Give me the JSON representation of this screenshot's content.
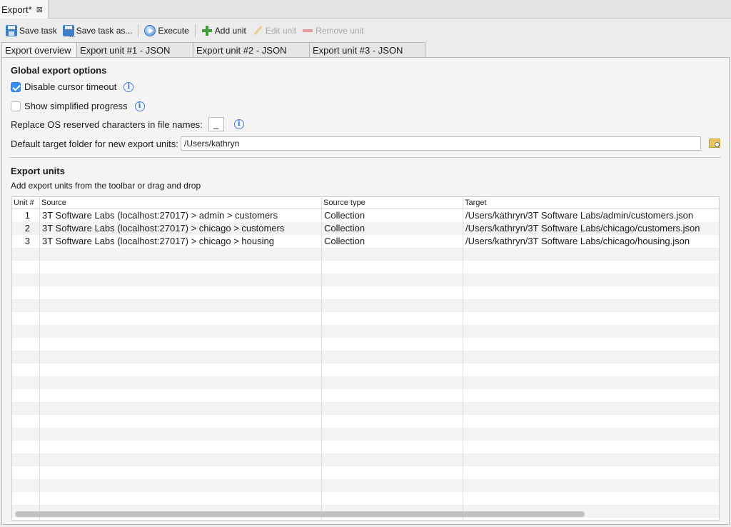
{
  "editor_tab": {
    "title": "Export*",
    "close_glyph": "⊠"
  },
  "toolbar": {
    "save_task": "Save task",
    "save_task_as": "Save task as...",
    "execute": "Execute",
    "add_unit": "Add unit",
    "edit_unit": "Edit unit",
    "remove_unit": "Remove unit"
  },
  "tabs": [
    {
      "label": "Export overview"
    },
    {
      "label": "Export unit #1 - JSON"
    },
    {
      "label": "Export unit #2 - JSON"
    },
    {
      "label": "Export unit #3 - JSON"
    }
  ],
  "global_options": {
    "title": "Global export options",
    "disable_cursor_timeout": {
      "label": "Disable cursor timeout",
      "checked": true
    },
    "show_simplified_progress": {
      "label": "Show simplified progress",
      "checked": false
    },
    "replace_os_chars": {
      "label": "Replace OS reserved characters in file names:",
      "value": "_"
    },
    "default_target_folder": {
      "label": "Default target folder for new export units:",
      "value": "/Users/kathryn"
    },
    "info_glyph": "i"
  },
  "export_units": {
    "title": "Export units",
    "hint": "Add export units from the toolbar or drag and drop",
    "columns": {
      "unit": "Unit #",
      "source": "Source",
      "source_type": "Source type",
      "target": "Target"
    },
    "rows": [
      {
        "unit": "1",
        "source": "3T Software Labs (localhost:27017) > admin > customers",
        "source_type": "Collection",
        "target": "/Users/kathryn/3T Software Labs/admin/customers.json"
      },
      {
        "unit": "2",
        "source": "3T Software Labs (localhost:27017) > chicago > customers",
        "source_type": "Collection",
        "target": "/Users/kathryn/3T Software Labs/chicago/customers.json"
      },
      {
        "unit": "3",
        "source": "3T Software Labs (localhost:27017) > chicago > housing",
        "source_type": "Collection",
        "target": "/Users/kathryn/3T Software Labs/chicago/housing.json"
      }
    ]
  }
}
